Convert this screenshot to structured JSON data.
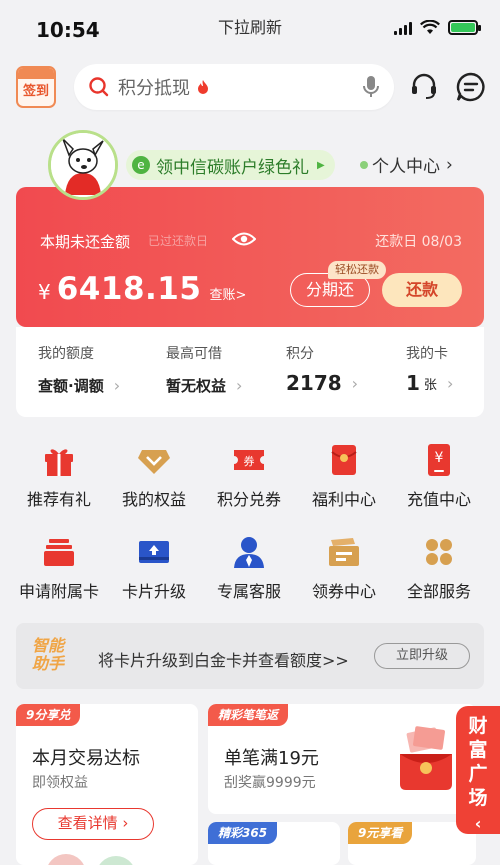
{
  "status_bar": {
    "time": "10:54",
    "center": "下拉刷新"
  },
  "top": {
    "signin_label": "签到",
    "search_placeholder": "积分抵现"
  },
  "user": {
    "carbon_text": "领中信碳账户绿色礼",
    "personal_center": "个人中心"
  },
  "bill": {
    "label": "本期未还金额",
    "overdue": "已过还款日",
    "due_date": "还款日 08/03",
    "currency": "¥",
    "amount": "6418.15",
    "check": "查账>",
    "installment_tag": "轻松还款",
    "installment": "分期还",
    "repay": "还款"
  },
  "stats": [
    {
      "label": "我的额度",
      "value": "查额·调额"
    },
    {
      "label": "最高可借",
      "value": "暂无权益"
    },
    {
      "label": "积分",
      "value": "2178"
    },
    {
      "label": "我的卡",
      "value": "1",
      "unit": "张"
    }
  ],
  "grid": [
    {
      "label": "推荐有礼",
      "icon": "gift-icon"
    },
    {
      "label": "我的权益",
      "icon": "diamond-icon"
    },
    {
      "label": "积分兑券",
      "icon": "coupon-icon",
      "badge": "券"
    },
    {
      "label": "福利中心",
      "icon": "red-envelope-icon"
    },
    {
      "label": "充值中心",
      "icon": "recharge-icon",
      "badge": "¥"
    },
    {
      "label": "申请附属卡",
      "icon": "card-stack-icon"
    },
    {
      "label": "卡片升级",
      "icon": "card-upgrade-icon"
    },
    {
      "label": "专属客服",
      "icon": "agent-icon"
    },
    {
      "label": "领券中心",
      "icon": "ticket-icon"
    },
    {
      "label": "全部服务",
      "icon": "all-services-icon"
    }
  ],
  "banner": {
    "logo": "智能助手",
    "text": "将卡片升级到白金卡并查看额度>>",
    "button": "立即升级"
  },
  "cards": {
    "c1": {
      "tag": "9分享兑",
      "title": "本月交易达标",
      "sub": "即领权益",
      "button": "查看详情"
    },
    "c2": {
      "tag": "精彩笔笔返",
      "title": "单笔满19元",
      "sub": "刮奖赢9999元"
    },
    "c3": {
      "tag": "精彩365"
    },
    "c4": {
      "tag": "9元享看"
    }
  },
  "wealth_tab": "财富广场",
  "colors": {
    "brand_red": "#f14a4f",
    "accent_gold": "#fde6bd",
    "green": "#4fb442"
  }
}
